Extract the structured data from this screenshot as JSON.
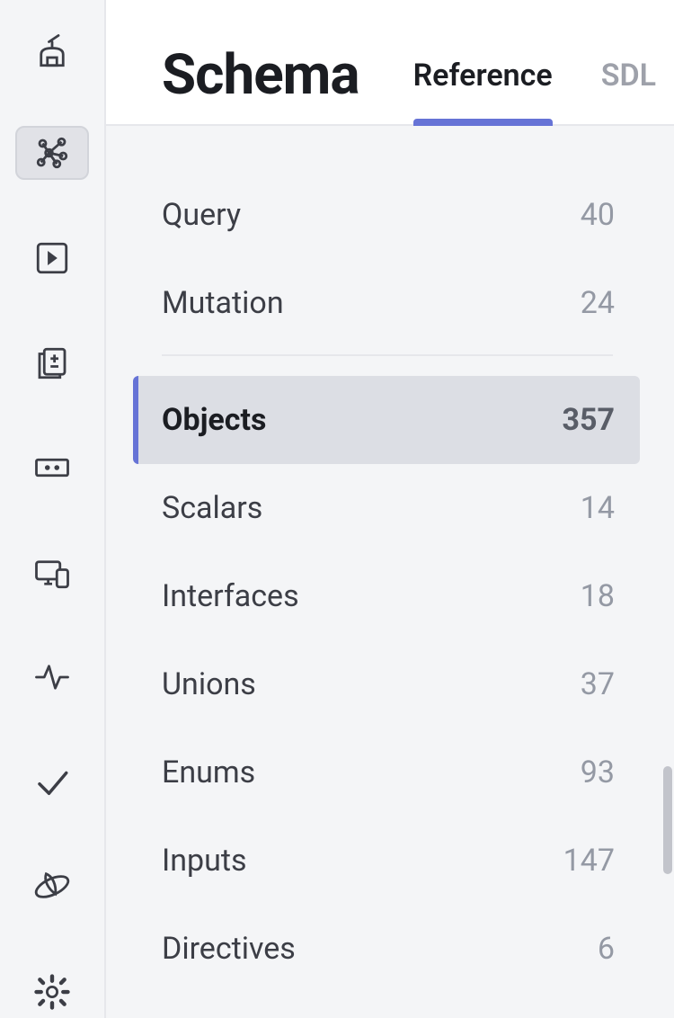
{
  "header": {
    "title": "Schema",
    "tabs": [
      {
        "label": "Reference",
        "active": true
      },
      {
        "label": "SDL",
        "active": false
      }
    ]
  },
  "sidebar": {
    "items": [
      {
        "name": "observatory-icon",
        "active": false
      },
      {
        "name": "schema-icon",
        "active": true
      },
      {
        "name": "explorer-icon",
        "active": false
      },
      {
        "name": "diff-icon",
        "active": false
      },
      {
        "name": "fields-icon",
        "active": false
      },
      {
        "name": "clients-icon",
        "active": false
      },
      {
        "name": "activity-icon",
        "active": false
      },
      {
        "name": "checks-icon",
        "active": false
      },
      {
        "name": "launch-icon",
        "active": false
      },
      {
        "name": "settings-icon",
        "active": false
      }
    ]
  },
  "categories": {
    "root": [
      {
        "label": "Query",
        "count": "40"
      },
      {
        "label": "Mutation",
        "count": "24"
      }
    ],
    "types": [
      {
        "label": "Objects",
        "count": "357",
        "selected": true
      },
      {
        "label": "Scalars",
        "count": "14"
      },
      {
        "label": "Interfaces",
        "count": "18"
      },
      {
        "label": "Unions",
        "count": "37"
      },
      {
        "label": "Enums",
        "count": "93"
      },
      {
        "label": "Inputs",
        "count": "147"
      },
      {
        "label": "Directives",
        "count": "6"
      }
    ]
  }
}
